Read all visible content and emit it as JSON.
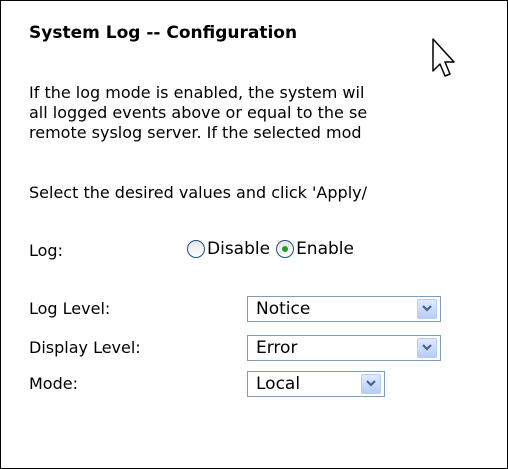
{
  "page": {
    "title": "System Log -- Configuration",
    "description_lines": [
      "If the log mode is enabled, the system wil",
      "all logged events above or equal to the se",
      "remote syslog server. If the selected mod"
    ],
    "instruction": "Select the desired values and click 'Apply/"
  },
  "form": {
    "log": {
      "label": "Log:",
      "options": [
        {
          "label": "Disable",
          "selected": false
        },
        {
          "label": "Enable",
          "selected": true
        }
      ]
    },
    "log_level": {
      "label": "Log Level:",
      "value": "Notice"
    },
    "display_level": {
      "label": "Display Level:",
      "value": "Error"
    },
    "mode": {
      "label": "Mode:",
      "value": "Local"
    }
  },
  "colors": {
    "select_border": "#7f9db9",
    "arrow_button": "#b6cdf7",
    "radio_checked_dot": "#21a121"
  },
  "icons": {
    "cursor": "mouse-pointer-icon",
    "dropdown": "chevron-down-icon"
  }
}
